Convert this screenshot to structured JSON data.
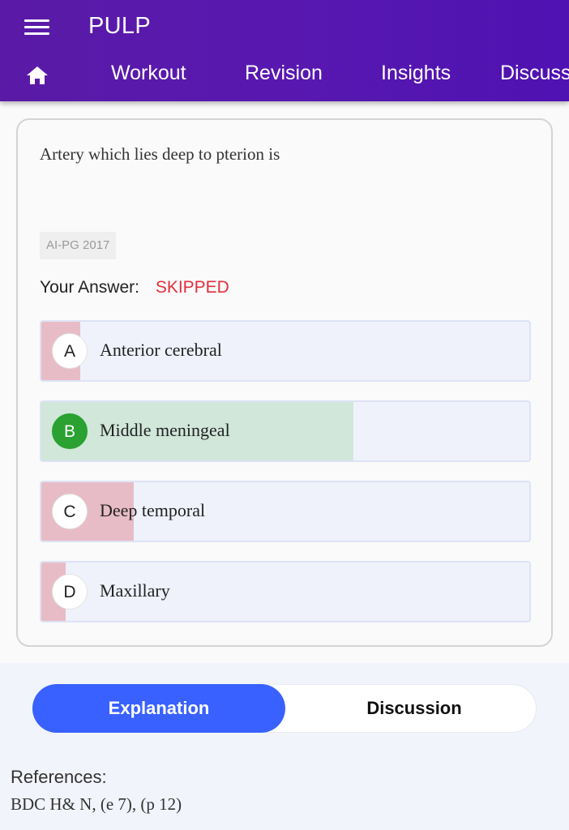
{
  "header": {
    "app_title": "PULP",
    "menu_icon": "hamburger-menu-icon",
    "home_icon": "home-icon",
    "nav": [
      "Workout",
      "Revision",
      "Insights",
      "Discuss"
    ]
  },
  "question": {
    "text": "Artery which lies deep to pterion is",
    "tag": "AI-PG 2017",
    "your_answer_label": "Your Answer:",
    "your_answer_value": "SKIPPED",
    "options": [
      {
        "letter": "A",
        "label": "Anterior cerebral",
        "response_fraction": 0.08,
        "correct": false
      },
      {
        "letter": "B",
        "label": "Middle meningeal",
        "response_fraction": 0.64,
        "correct": true
      },
      {
        "letter": "C",
        "label": "Deep temporal",
        "response_fraction": 0.19,
        "correct": false
      },
      {
        "letter": "D",
        "label": "Maxillary",
        "response_fraction": 0.05,
        "correct": false
      }
    ]
  },
  "tabs": {
    "explanation": "Explanation",
    "discussion": "Discussion",
    "active": "Explanation"
  },
  "references": {
    "heading": "References:",
    "text": "BDC H& N, (e 7), (p 12)"
  },
  "colors": {
    "header_bg": "#5818b0",
    "wrong_fill": "#e8bcc6",
    "correct_fill": "#d0e7da",
    "correct_badge": "#2aa130",
    "skipped": "#e0303d",
    "active_tab": "#3861ff"
  }
}
